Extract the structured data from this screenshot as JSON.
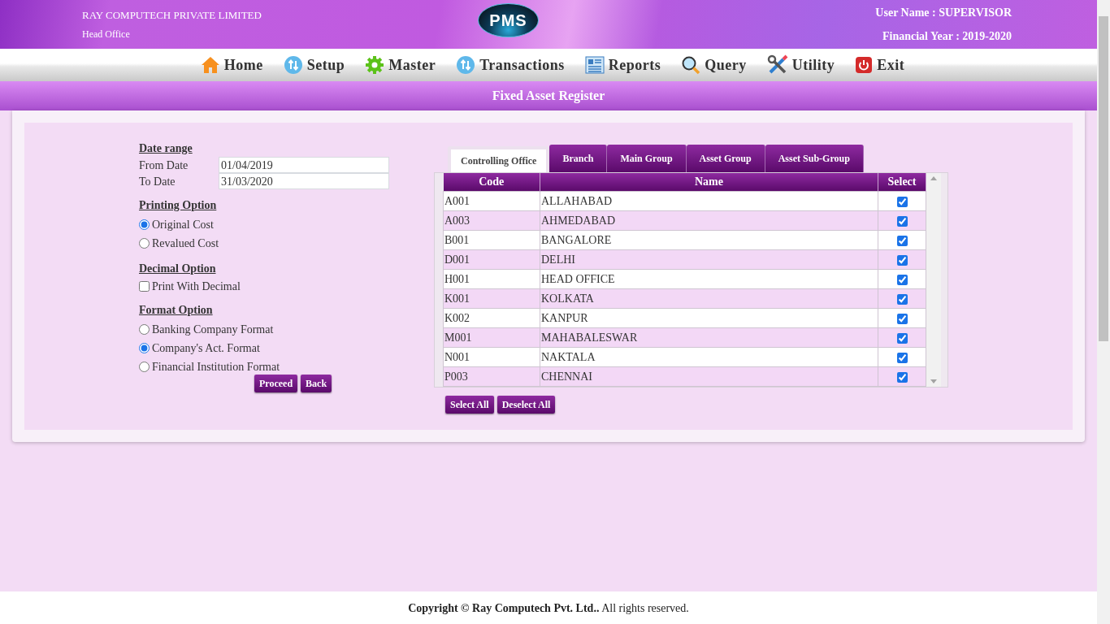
{
  "header": {
    "company": "RAY COMPUTECH PRIVATE LIMITED",
    "office": "Head Office",
    "logo": "PMS",
    "user_name": "User Name : SUPERVISOR",
    "financial_year": "Financial Year : 2019-2020"
  },
  "menu": [
    {
      "label": "Home",
      "kind": "home"
    },
    {
      "label": "Setup",
      "kind": "arrows"
    },
    {
      "label": "Master",
      "kind": "gear"
    },
    {
      "label": "Transactions",
      "kind": "arrows"
    },
    {
      "label": "Reports",
      "kind": "report"
    },
    {
      "label": "Query",
      "kind": "magnifier"
    },
    {
      "label": "Utility",
      "kind": "tools"
    },
    {
      "label": "Exit",
      "kind": "power"
    }
  ],
  "page_title": "Fixed Asset Register",
  "date_range": {
    "heading": "Date range",
    "fields": [
      {
        "label": "From Date",
        "value": "01/04/2019"
      },
      {
        "label": "To Date",
        "value": "31/03/2020"
      }
    ]
  },
  "printing_option": {
    "heading": "Printing Option",
    "options": [
      {
        "label": "Original Cost",
        "selected": true
      },
      {
        "label": "Revalued Cost",
        "selected": false
      }
    ]
  },
  "decimal_option": {
    "heading": "Decimal Option",
    "options": [
      {
        "label": "Print With Decimal",
        "checked": false
      }
    ]
  },
  "format_option": {
    "heading": "Format Option",
    "options": [
      {
        "label": "Banking Company Format",
        "selected": false
      },
      {
        "label": "Company's Act. Format",
        "selected": true
      },
      {
        "label": "Financial Institution Format",
        "selected": false
      }
    ]
  },
  "buttons": [
    "Proceed",
    "Back"
  ],
  "tabs": [
    {
      "label": "Controlling Office",
      "selected": true
    },
    {
      "label": "Branch",
      "selected": false
    },
    {
      "label": "Main Group",
      "selected": false
    },
    {
      "label": "Asset Group",
      "selected": false
    },
    {
      "label": "Asset Sub-Group",
      "selected": false
    }
  ],
  "table": {
    "columns": [
      "Code",
      "Name",
      "Select"
    ],
    "rows": [
      {
        "code": "A001",
        "name": "ALLAHABAD",
        "checked": true
      },
      {
        "code": "A003",
        "name": "AHMEDABAD",
        "checked": true
      },
      {
        "code": "B001",
        "name": "BANGALORE",
        "checked": true
      },
      {
        "code": "D001",
        "name": "DELHI",
        "checked": true
      },
      {
        "code": "H001",
        "name": "HEAD OFFICE",
        "checked": true
      },
      {
        "code": "K001",
        "name": "KOLKATA",
        "checked": true
      },
      {
        "code": "K002",
        "name": "KANPUR",
        "checked": true
      },
      {
        "code": "M001",
        "name": "MAHABALESWAR",
        "checked": true
      },
      {
        "code": "N001",
        "name": "NAKTALA",
        "checked": true
      },
      {
        "code": "P003",
        "name": "CHENNAI",
        "checked": true
      }
    ]
  },
  "table_buttons": [
    "Select All",
    "Deselect All"
  ],
  "footer": "**Copyright © Ray Computech Pvt. Ltd..** All rights reserved."
}
